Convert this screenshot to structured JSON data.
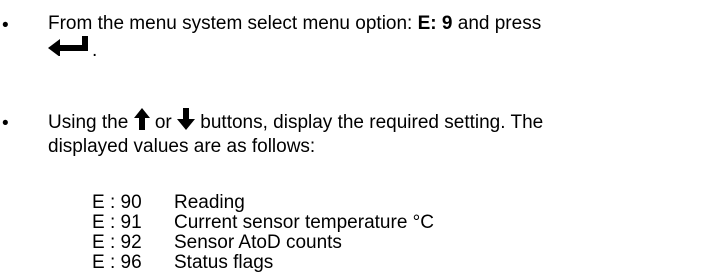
{
  "step1": {
    "text_before": "From the menu system select menu option: ",
    "option": "E: 9",
    "text_after": " and press",
    "end_punct": ".",
    "enter_icon": "enter-arrow-icon"
  },
  "step2": {
    "text_using": "Using the ",
    "up_icon": "up-arrow-icon",
    "text_or": " or ",
    "down_icon": "down-arrow-icon",
    "text_rest": " buttons, display the required setting. The",
    "line2": "displayed values are as follows:"
  },
  "values": [
    {
      "code": "E : 90",
      "desc": "Reading"
    },
    {
      "code": "E : 91",
      "desc": "Current sensor temperature °C"
    },
    {
      "code": "E : 92",
      "desc": "Sensor AtoD counts"
    },
    {
      "code": "E : 96",
      "desc": "Status flags"
    }
  ],
  "colors": {
    "text": "#000000",
    "background": "#ffffff"
  }
}
